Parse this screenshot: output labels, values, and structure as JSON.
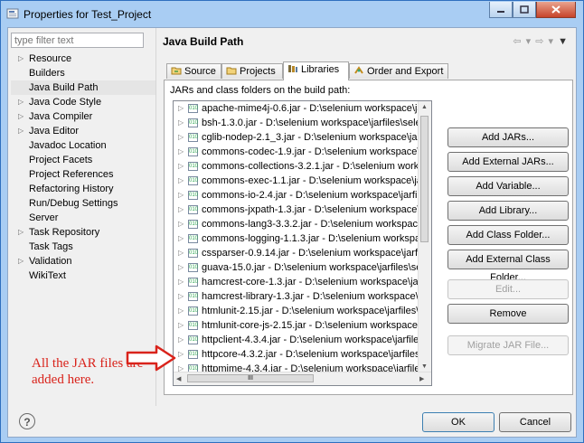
{
  "window": {
    "title": "Properties for Test_Project",
    "buttons": [
      "minimize",
      "maximize",
      "close"
    ]
  },
  "filter": {
    "placeholder": "type filter text"
  },
  "nav": {
    "items": [
      {
        "label": "Resource",
        "expandable": true
      },
      {
        "label": "Builders",
        "expandable": false
      },
      {
        "label": "Java Build Path",
        "expandable": false,
        "selected": true
      },
      {
        "label": "Java Code Style",
        "expandable": true
      },
      {
        "label": "Java Compiler",
        "expandable": true
      },
      {
        "label": "Java Editor",
        "expandable": true
      },
      {
        "label": "Javadoc Location",
        "expandable": false
      },
      {
        "label": "Project Facets",
        "expandable": false
      },
      {
        "label": "Project References",
        "expandable": false
      },
      {
        "label": "Refactoring History",
        "expandable": false
      },
      {
        "label": "Run/Debug Settings",
        "expandable": false
      },
      {
        "label": "Server",
        "expandable": false
      },
      {
        "label": "Task Repository",
        "expandable": true
      },
      {
        "label": "Task Tags",
        "expandable": false
      },
      {
        "label": "Validation",
        "expandable": true
      },
      {
        "label": "WikiText",
        "expandable": false
      }
    ]
  },
  "page": {
    "title": "Java Build Path"
  },
  "tabs": [
    {
      "label": "Source",
      "icon": "source-folder-icon"
    },
    {
      "label": "Projects",
      "icon": "projects-icon"
    },
    {
      "label": "Libraries",
      "icon": "libraries-icon",
      "active": true
    },
    {
      "label": "Order and Export",
      "icon": "order-export-icon"
    }
  ],
  "libraries": {
    "label": "JARs and class folders on the build path:",
    "jars": [
      "apache-mime4j-0.6.jar - D:\\selenium workspace\\jarf",
      "bsh-1.3.0.jar - D:\\selenium workspace\\jarfiles\\seleni",
      "cglib-nodep-2.1_3.jar - D:\\selenium workspace\\jarfil",
      "commons-codec-1.9.jar - D:\\selenium workspace\\jarfi",
      "commons-collections-3.2.1.jar - D:\\selenium worksp",
      "commons-exec-1.1.jar - D:\\selenium workspace\\jarf",
      "commons-io-2.4.jar - D:\\selenium workspace\\jarfile",
      "commons-jxpath-1.3.jar - D:\\selenium workspace\\ja",
      "commons-lang3-3.3.2.jar - D:\\selenium workspace\\j",
      "commons-logging-1.1.3.jar - D:\\selenium workspac",
      "cssparser-0.9.14.jar - D:\\selenium workspace\\jarfiles\\",
      "guava-15.0.jar - D:\\selenium workspace\\jarfiles\\selen",
      "hamcrest-core-1.3.jar - D:\\selenium workspace\\jarfil",
      "hamcrest-library-1.3.jar - D:\\selenium workspace\\jarfi",
      "htmlunit-2.15.jar - D:\\selenium workspace\\jarfiles\\se",
      "htmlunit-core-js-2.15.jar - D:\\selenium workspace\\ja",
      "httpclient-4.3.4.jar - D:\\selenium workspace\\jarfiles\\",
      "httpcore-4.3.2.jar - D:\\selenium workspace\\jarfiles\\s",
      "httpmime-4.3.4.jar - D:\\selenium workspace\\jarfiles\\"
    ],
    "hscroll_label": "III"
  },
  "actions": {
    "add_jars": "Add JARs...",
    "add_external_jars": "Add External JARs...",
    "add_variable": "Add Variable...",
    "add_library": "Add Library...",
    "add_class_folder": "Add Class Folder...",
    "add_external_class_folder": "Add External Class Folder...",
    "edit": "Edit...",
    "remove": "Remove",
    "migrate_jar": "Migrate JAR File..."
  },
  "footer": {
    "help": "?",
    "ok": "OK",
    "cancel": "Cancel"
  },
  "annotation": {
    "text": "All the JAR files are added here.",
    "color": "#d9231b"
  }
}
